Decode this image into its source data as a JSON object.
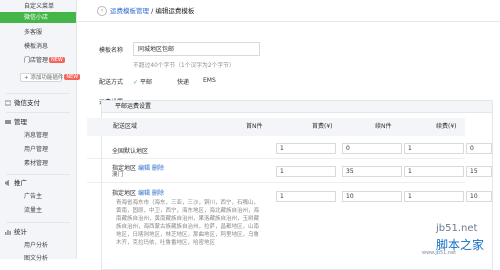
{
  "sidebar": {
    "items_top": [
      {
        "label": "自定义菜单"
      },
      {
        "label": "微信小店",
        "active": true
      },
      {
        "label": "多客服"
      },
      {
        "label": "模板消息"
      },
      {
        "label": "门店管理",
        "badge": "NEW"
      }
    ],
    "add_button": "+ 添加功能插件",
    "badge_new": "NEW",
    "sections": [
      {
        "title": "微信支付"
      },
      {
        "title": "管理",
        "items": [
          "消息管理",
          "用户管理",
          "素材管理"
        ]
      },
      {
        "title": "推广",
        "items": [
          "广告主",
          "流量主"
        ]
      },
      {
        "title": "统计",
        "items": [
          "用户分析",
          "图文分析"
        ]
      }
    ]
  },
  "breadcrumb": {
    "parent": "运费模板管理",
    "separator": "/",
    "current": "编辑运费模板"
  },
  "form": {
    "name_label": "模板名称",
    "name_value": "同城地区包邮",
    "name_hint": "不超过40个字节（1个汉字为2个字节）",
    "method_label": "配送方式",
    "methods": [
      {
        "label": "平邮",
        "checked": true
      },
      {
        "label": "快递",
        "checked": false
      },
      {
        "label": "EMS",
        "checked": false
      }
    ],
    "fee_label": "运费设置"
  },
  "panel": {
    "title": "平邮运费设置",
    "columns": [
      "配送区域",
      "首N件",
      "首费(¥)",
      "续N件",
      "续费(¥)"
    ],
    "rows": [
      {
        "region": "全国默认地区",
        "actions": [],
        "sub": "",
        "values": [
          "1",
          "0",
          "1",
          "0"
        ]
      },
      {
        "region": "指定地区",
        "actions": [
          "编辑",
          "删除"
        ],
        "sub": "澳门",
        "values": [
          "1",
          "35",
          "1",
          "15"
        ]
      },
      {
        "region": "指定地区",
        "actions": [
          "编辑",
          "删除"
        ],
        "sub": "",
        "values": [
          "1",
          "10",
          "1",
          "10"
        ]
      }
    ],
    "region_list": "青海省海东市（海东，三亚，三沙，铜川，西宁，石嘴山，黄南，固原，中卫，西宁，海东地区，海北藏族自治州，海南藏族自治州，黄南藏族自治州，果洛藏族自治州，玉树藏族自治州，海西蒙古族藏族自治州，拉萨，昌都地区，山南地区，日喀则地区，林芝地区，那曲地区，阿里地区，乌鲁木齐，克拉玛依，吐鲁番地区，哈密地区"
  },
  "watermark": {
    "line1": "jb51.net",
    "line2": "脚本之家",
    "line3": "www.jb51.net"
  }
}
